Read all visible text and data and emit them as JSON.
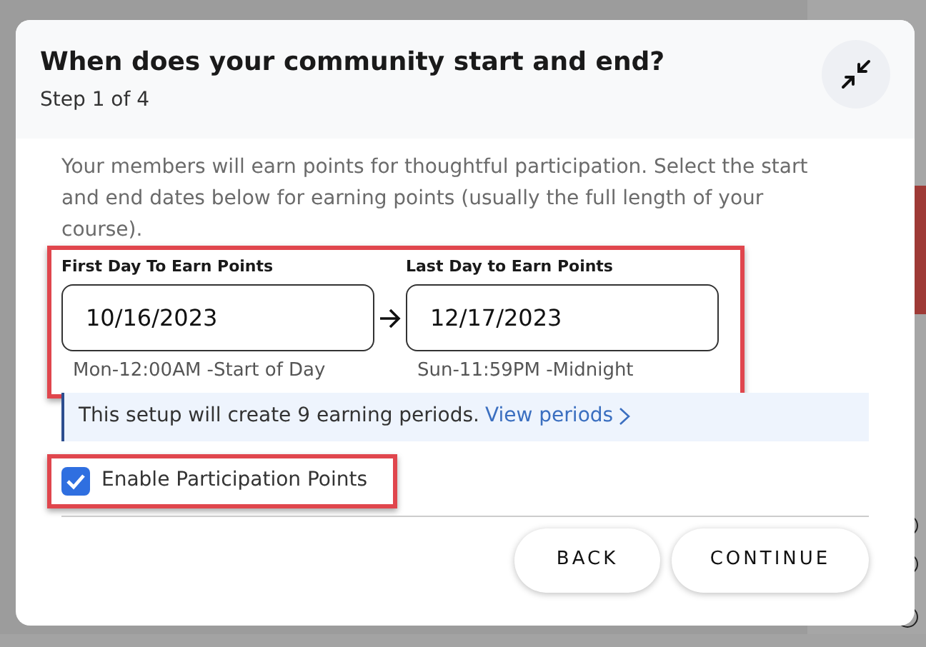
{
  "dialog": {
    "title": "When does your community start and end?",
    "step": "Step 1 of 4",
    "description": "Your members will earn points for thoughtful participation. Select the start and end dates below for earning points (usually the full length of your course).",
    "date_range": {
      "highlighted": true,
      "fields": [
        {
          "label": "First Day To Earn Points",
          "value": "10/16/2023",
          "hint": "Mon-12:00AM -Start of Day"
        },
        {
          "label": "Last Day to Earn Points",
          "value": "12/17/2023",
          "hint": "Sun-11:59PM -Midnight"
        }
      ]
    },
    "info": {
      "text": "This setup will create 9 earning periods.",
      "link": "View periods"
    },
    "checkbox": {
      "label": "Enable Participation Points",
      "checked": true,
      "highlighted": true
    },
    "buttons": [
      "BACK",
      "CONTINUE"
    ]
  }
}
